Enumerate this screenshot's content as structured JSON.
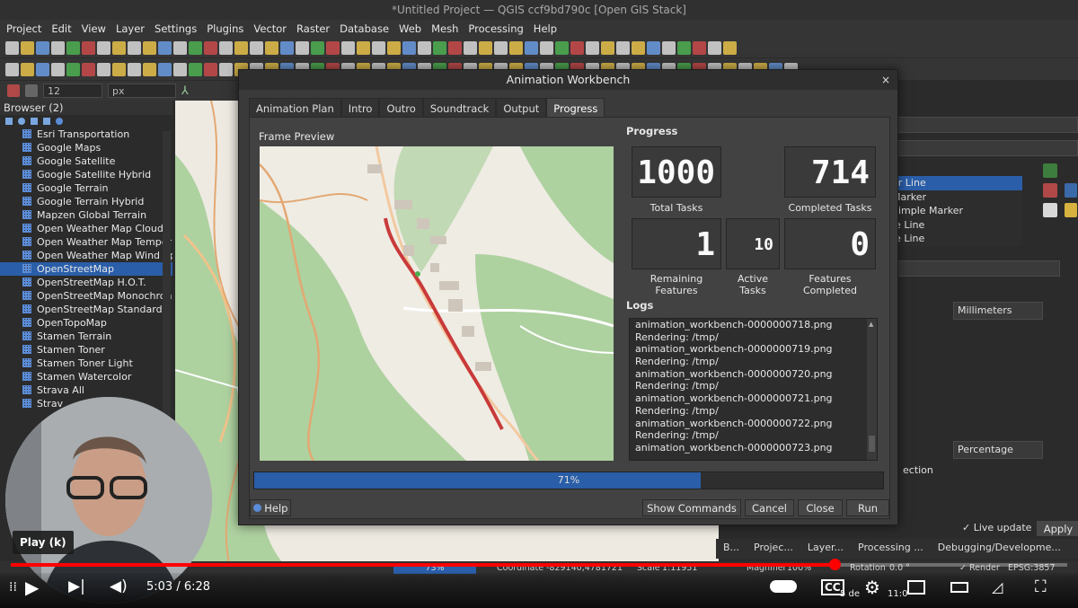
{
  "window": {
    "title": "*Untitled Project — QGIS ccf9bd790c [Open GIS Stack]"
  },
  "menu": [
    "Project",
    "Edit",
    "View",
    "Layer",
    "Settings",
    "Plugins",
    "Vector",
    "Raster",
    "Database",
    "Web",
    "Mesh",
    "Processing",
    "Help"
  ],
  "style_toolbar": {
    "size_value": "12",
    "unit": "px"
  },
  "browser": {
    "title": "Browser (2)",
    "items": [
      {
        "label": "Esri Transportation",
        "selected": false
      },
      {
        "label": "Google Maps",
        "selected": false
      },
      {
        "label": "Google Satellite",
        "selected": false
      },
      {
        "label": "Google Satellite Hybrid",
        "selected": false
      },
      {
        "label": "Google Terrain",
        "selected": false
      },
      {
        "label": "Google Terrain Hybrid",
        "selected": false
      },
      {
        "label": "Mapzen Global Terrain",
        "selected": false
      },
      {
        "label": "Open Weather Map Clouds",
        "selected": false
      },
      {
        "label": "Open Weather Map Temper",
        "selected": false
      },
      {
        "label": "Open Weather Map Wind Sp",
        "selected": false
      },
      {
        "label": "OpenStreetMap",
        "selected": true
      },
      {
        "label": "OpenStreetMap H.O.T.",
        "selected": false
      },
      {
        "label": "OpenStreetMap Monochron",
        "selected": false
      },
      {
        "label": "OpenStreetMap Standard",
        "selected": false
      },
      {
        "label": "OpenTopoMap",
        "selected": false
      },
      {
        "label": "Stamen Terrain",
        "selected": false
      },
      {
        "label": "Stamen Toner",
        "selected": false
      },
      {
        "label": "Stamen Toner Light",
        "selected": false
      },
      {
        "label": "Stamen Watercolor",
        "selected": false
      },
      {
        "label": "Strava All",
        "selected": false
      },
      {
        "label": "Strav",
        "selected": false
      }
    ]
  },
  "right_dock": {
    "symbol_layers": [
      "er Line",
      "Marker",
      "Simple Marker",
      "le Line",
      "le Line"
    ],
    "unit_select": "Millimeters",
    "percentage_select": "Percentage",
    "ection_label": "ection",
    "live_update": "Live update",
    "apply": "Apply"
  },
  "dialog": {
    "title": "Animation Workbench",
    "close": "×",
    "tabs": [
      {
        "label": "Animation Plan",
        "active": false
      },
      {
        "label": "Intro",
        "active": false
      },
      {
        "label": "Outro",
        "active": false
      },
      {
        "label": "Soundtrack",
        "active": false
      },
      {
        "label": "Output",
        "active": false
      },
      {
        "label": "Progress",
        "active": true
      }
    ],
    "frame_preview_label": "Frame Preview",
    "progress_label": "Progress",
    "counters": {
      "total_tasks": {
        "value": "1000",
        "caption": "Total Tasks"
      },
      "completed_tasks": {
        "value": "714",
        "caption": "Completed Tasks"
      },
      "remaining_features": {
        "value": "1",
        "caption": "Remaining Features"
      },
      "active_tasks": {
        "value": "10",
        "caption": "Active Tasks"
      },
      "features_completed": {
        "value": "0",
        "caption": "Features Completed"
      }
    },
    "logs_label": "Logs",
    "logs": [
      "animation_workbench-0000000718.png",
      "Rendering: /tmp/",
      "animation_workbench-0000000719.png",
      "Rendering: /tmp/",
      "animation_workbench-0000000720.png",
      "Rendering: /tmp/",
      "animation_workbench-0000000721.png",
      "Rendering: /tmp/",
      "animation_workbench-0000000722.png",
      "Rendering: /tmp/",
      "animation_workbench-0000000723.png"
    ],
    "progress": {
      "fraction": 0.71,
      "text": "71%"
    },
    "buttons": {
      "help": "Help",
      "show_commands": "Show Commands",
      "cancel": "Cancel",
      "close": "Close",
      "run": "Run"
    }
  },
  "bottom_tabs": [
    "B...",
    "Projec...",
    "Layer...",
    "Processing ...",
    "Debugging/Developme..."
  ],
  "status": {
    "progress_text": "73%",
    "coordinate_label": "Coordinate",
    "coordinate_value": "-829140,4781721",
    "scale_label": "Scale",
    "scale_value": "1:11951",
    "magnifier_label": "Magnifier",
    "magnifier_value": "100%",
    "rotation_label": "Rotation",
    "rotation_value": "0.0 °",
    "render_label": "Render",
    "crs": "EPSG:3857"
  },
  "video": {
    "tooltip": "Play (k)",
    "time": "5:03 / 6:28",
    "played_fraction": 0.78,
    "side_text": "5 de",
    "side_time": "11:0",
    "play_icon": "play-icon",
    "colors": {
      "played": "#ff0000"
    }
  },
  "colors": {
    "selection": "#2a5ea8",
    "dialog_bg": "#3a3a3a",
    "route": "#c93a3a"
  }
}
